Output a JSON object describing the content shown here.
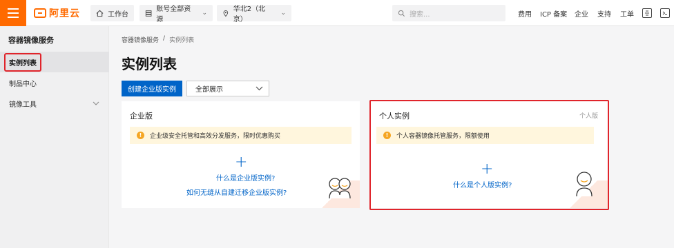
{
  "topbar": {
    "logo_mark": "[-]",
    "logo_text": "阿里云",
    "workbench": "工作台",
    "account_resources": "账号全部资源",
    "region": "华北2（北京）",
    "search_placeholder": "搜索...",
    "links": [
      "费用",
      "ICP 备案",
      "企业",
      "支持",
      "工单"
    ]
  },
  "sidebar": {
    "title": "容器镜像服务",
    "items": [
      {
        "label": "实例列表"
      },
      {
        "label": "制品中心"
      },
      {
        "label": "镜像工具"
      }
    ]
  },
  "main": {
    "breadcrumb": [
      "容器镜像服务",
      "/",
      "实例列表"
    ],
    "title": "实例列表",
    "create_button": "创建企业版实例",
    "filter_select": "全部展示"
  },
  "cards": {
    "enterprise": {
      "title": "企业版",
      "notice": "企业级安全托管和高效分发服务，限时优惠购买",
      "plus": "+",
      "link1": "什么是企业版实例?",
      "link2": "如何无缝从自建迁移企业版实例?"
    },
    "personal": {
      "title": "个人实例",
      "tag": "个人版",
      "notice": "个人容器镜像托管服务，限额使用",
      "plus": "+",
      "link1": "什么是个人版实例?"
    }
  },
  "colors": {
    "brand": "#ff6a00",
    "primary": "#0064c8",
    "highlight": "#e0242b"
  }
}
